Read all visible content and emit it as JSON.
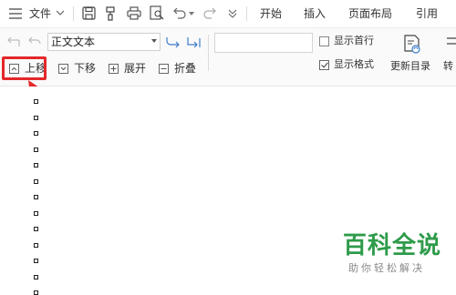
{
  "topbar": {
    "file_label": "文件",
    "tabs": [
      "开始",
      "插入",
      "页面布局",
      "引用"
    ]
  },
  "ribbon": {
    "style_value": "正文文本",
    "show_first_line": "显示首行",
    "show_format": "显示格式",
    "show_first_line_checked": false,
    "show_format_checked": true,
    "update_toc": "更新目录",
    "convert_partial": "转",
    "outline": {
      "move_up": "上移",
      "move_down": "下移",
      "expand": "展开",
      "collapse": "折叠"
    }
  },
  "annotation": {
    "highlight_color": "#e3282a"
  },
  "document": {
    "outline_bullet_count": 13
  },
  "watermark": {
    "title": "百科全说",
    "subtitle": "助你轻松解决",
    "color": "#2e9b4a"
  }
}
